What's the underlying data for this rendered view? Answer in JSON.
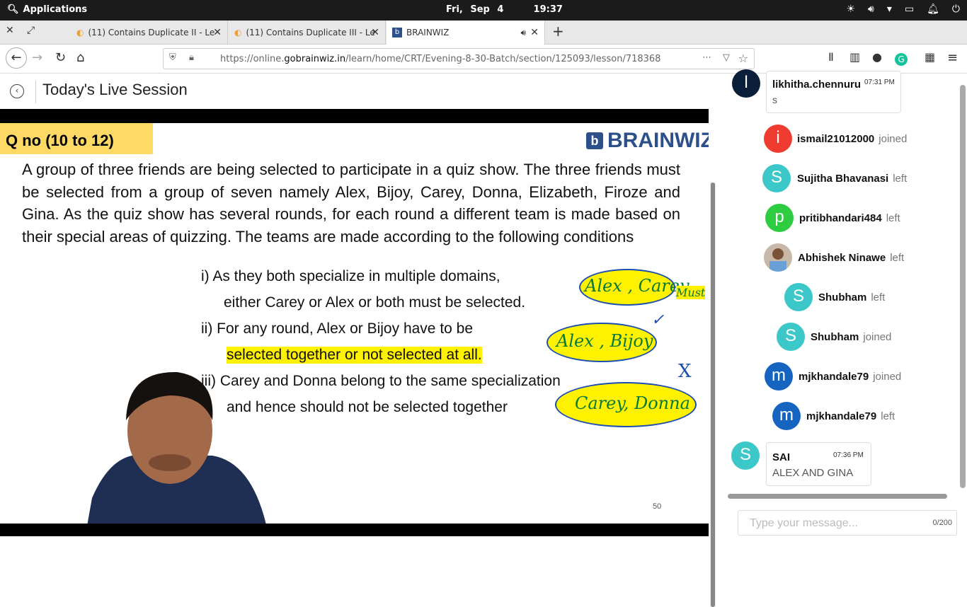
{
  "os": {
    "apps_label": "Applications",
    "date": "Fri, Sep  4",
    "time": "19:37"
  },
  "tabs": [
    {
      "title": "(11) Contains Duplicate II - Le"
    },
    {
      "title": "(11) Contains Duplicate III - Le"
    },
    {
      "title": "BRAINWIZ"
    }
  ],
  "nav": {
    "url_pre": "https://online.",
    "url_host": "gobrainwiz.in",
    "url_path": "/learn/home/CRT/Evening-8-30-Batch/section/125093/lesson/718368"
  },
  "page": {
    "title": "Today's Live Session"
  },
  "slide": {
    "qno": "Q no (10 to 12)",
    "brand": "BRAINWIZ",
    "paragraph": "A group of three friends are being selected to participate in a quiz show. The three friends must be selected from a group of seven namely Alex, Bijoy, Carey, Donna, Elizabeth, Firoze and Gina. As the quiz show has several rounds, for each round a different team is made based on their special areas of quizzing. The teams are made according to the following conditions",
    "cond1a": "i)  As they both specialize in multiple domains,",
    "cond1b": "either  Carey or Alex or both must be selected.",
    "cond2a": "ii)  For any round, Alex or Bijoy have to be",
    "cond2b": "selected together or not selected at all.",
    "cond3a": "iii)  Carey and Donna belong to the same specialization",
    "cond3b": "and hence should not be selected together",
    "ink1": "Alex , Carey",
    "ink1b": "Must",
    "ink2": "Alex , Bijoy",
    "ink3": "Carey, Donna",
    "ink_x": "X",
    "page_number": "50"
  },
  "chat": {
    "messages": [
      {
        "user": "likhitha.chennuru",
        "time": "07:31 PM",
        "text": "s",
        "initial": "l"
      },
      {
        "user": "SAI",
        "time": "07:36 PM",
        "text": "ALEX AND GINA",
        "initial": "S"
      }
    ],
    "events": [
      {
        "initial": "i",
        "user": "ismail21012000",
        "action": "joined"
      },
      {
        "initial": "S",
        "user": "Sujitha Bhavanasi",
        "action": "left"
      },
      {
        "initial": "p",
        "user": "pritibhandari484",
        "action": "left"
      },
      {
        "initial": "",
        "user": "Abhishek Ninawe",
        "action": "left"
      },
      {
        "initial": "S",
        "user": "Shubham",
        "action": "left"
      },
      {
        "initial": "S",
        "user": "Shubham",
        "action": "joined"
      },
      {
        "initial": "m",
        "user": "mjkhandale79",
        "action": "joined"
      },
      {
        "initial": "m",
        "user": "mjkhandale79",
        "action": "left"
      }
    ],
    "input_placeholder": "Type your message...",
    "counter": "0/200"
  },
  "colors": {
    "red": "#f03b30",
    "teal": "#3cc8c8",
    "green": "#2ecc40",
    "blue": "#1565c0",
    "navy": "#0b1e3a"
  }
}
